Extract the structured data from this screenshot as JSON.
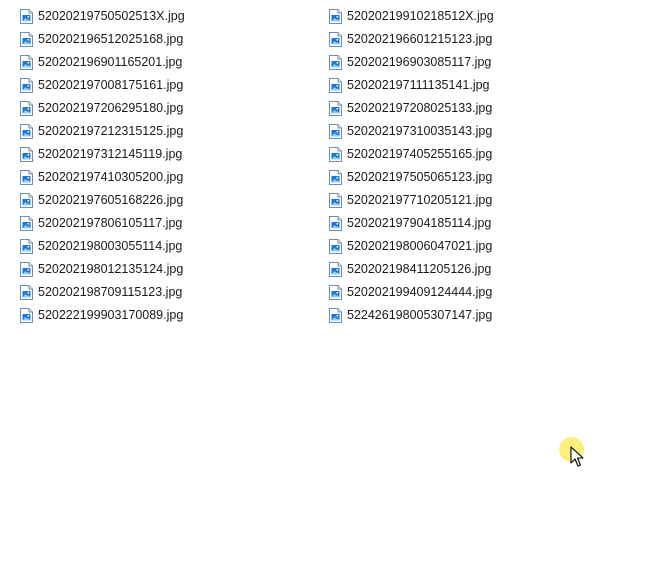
{
  "files": [
    {
      "name": "52020219750502513X.jpg",
      "icon": "image-file-icon"
    },
    {
      "name": "520202196512025168.jpg",
      "icon": "image-file-icon"
    },
    {
      "name": "520202196901165201.jpg",
      "icon": "image-file-icon"
    },
    {
      "name": "520202197008175161.jpg",
      "icon": "image-file-icon"
    },
    {
      "name": "520202197206295180.jpg",
      "icon": "image-file-icon"
    },
    {
      "name": "520202197212315125.jpg",
      "icon": "image-file-icon"
    },
    {
      "name": "520202197312145119.jpg",
      "icon": "image-file-icon"
    },
    {
      "name": "520202197410305200.jpg",
      "icon": "image-file-icon"
    },
    {
      "name": "520202197605168226.jpg",
      "icon": "image-file-icon"
    },
    {
      "name": "520202197806105117.jpg",
      "icon": "image-file-icon"
    },
    {
      "name": "520202198003055114.jpg",
      "icon": "image-file-icon"
    },
    {
      "name": "520202198012135124.jpg",
      "icon": "image-file-icon"
    },
    {
      "name": "520202198709115123.jpg",
      "icon": "image-file-icon"
    },
    {
      "name": "520222199903170089.jpg",
      "icon": "image-file-icon"
    },
    {
      "name": "52020219910218512X.jpg",
      "icon": "image-file-icon"
    },
    {
      "name": "520202196601215123.jpg",
      "icon": "image-file-icon"
    },
    {
      "name": "520202196903085117.jpg",
      "icon": "image-file-icon"
    },
    {
      "name": "520202197111135141.jpg",
      "icon": "image-file-icon"
    },
    {
      "name": "520202197208025133.jpg",
      "icon": "image-file-icon"
    },
    {
      "name": "520202197310035143.jpg",
      "icon": "image-file-icon"
    },
    {
      "name": "520202197405255165.jpg",
      "icon": "image-file-icon"
    },
    {
      "name": "520202197505065123.jpg",
      "icon": "image-file-icon"
    },
    {
      "name": "520202197710205121.jpg",
      "icon": "image-file-icon"
    },
    {
      "name": "520202197904185114.jpg",
      "icon": "image-file-icon"
    },
    {
      "name": "520202198006047021.jpg",
      "icon": "image-file-icon"
    },
    {
      "name": "520202198411205126.jpg",
      "icon": "image-file-icon"
    },
    {
      "name": "520202199409124444.jpg",
      "icon": "image-file-icon"
    },
    {
      "name": "522426198005307147.jpg",
      "icon": "image-file-icon"
    }
  ],
  "cursor": {
    "icon": "mouse-pointer-icon",
    "highlight_color": "#faeb64"
  },
  "colors": {
    "icon_blue": "#1e78d2",
    "icon_border": "#6f8fb0",
    "text": "#1a1a1a"
  }
}
